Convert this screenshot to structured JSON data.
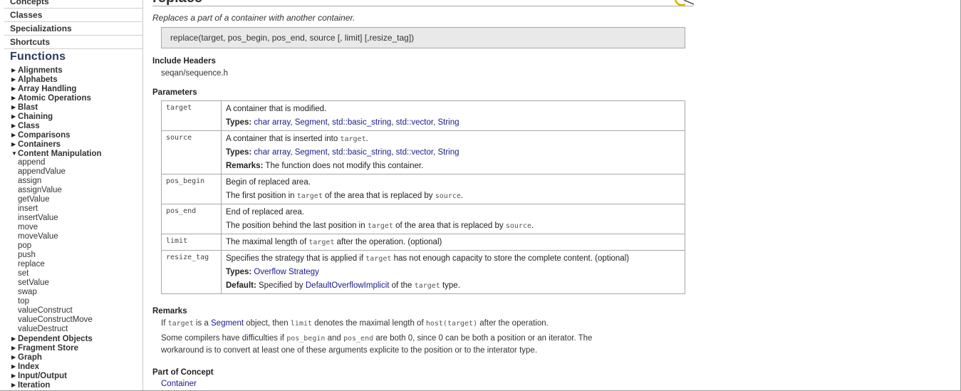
{
  "sidebar": {
    "top_links": [
      "Concepts",
      "Classes",
      "Specializations",
      "Shortcuts"
    ],
    "section_title": "Functions",
    "tree_before": [
      "Alignments",
      "Alphabets",
      "Array Handling",
      "Atomic Operations",
      "Blast",
      "Chaining",
      "Class",
      "Comparisons",
      "Containers"
    ],
    "expanded": "Content Manipulation",
    "sub_items": [
      "append",
      "appendValue",
      "assign",
      "assignValue",
      "getValue",
      "insert",
      "insertValue",
      "move",
      "moveValue",
      "pop",
      "push",
      "replace",
      "set",
      "setValue",
      "swap",
      "top",
      "valueConstruct",
      "valueConstructMove",
      "valueDestruct"
    ],
    "tree_after": [
      "Dependent Objects",
      "Fragment Store",
      "Graph",
      "Index",
      "Input/Output",
      "Iteration"
    ]
  },
  "main": {
    "title": "replace",
    "summary": "Replaces a part of a container with another container.",
    "signature": "replace(target, pos_begin, pos_end, source [, limit] [,resize_tag])",
    "include_heading": "Include Headers",
    "include_value": "seqan/sequence.h",
    "params_heading": "Parameters",
    "labels": {
      "types": "Types:",
      "remarks": "Remarks:",
      "default": "Default:"
    },
    "type_links": [
      "char array",
      "Segment",
      "std::basic_string",
      "std::vector",
      "String"
    ],
    "params": {
      "target": {
        "name": "target",
        "desc": "A container that is modified."
      },
      "source": {
        "name": "source",
        "desc_pre": "A container that is inserted into ",
        "desc_code": "target",
        "desc_post": ".",
        "remark": "The function does not modify this container."
      },
      "pos_begin": {
        "name": "pos_begin",
        "desc": "Begin of replaced area.",
        "l2_pre": "The first position in ",
        "l2_code1": "target",
        "l2_mid": " of the area that is replaced by ",
        "l2_code2": "source",
        "l2_post": "."
      },
      "pos_end": {
        "name": "pos_end",
        "desc": "End of replaced area.",
        "l2_pre": "The position behind the last position in ",
        "l2_code1": "target",
        "l2_mid": " of the area that is replaced by ",
        "l2_code2": "source",
        "l2_post": "."
      },
      "limit": {
        "name": "limit",
        "pre": "The maximal length of ",
        "code": "target",
        "post": " after the operation. (optional)"
      },
      "resize_tag": {
        "name": "resize_tag",
        "pre": "Specifies the strategy that is applied if ",
        "code": "target",
        "post": " has not enough capacity to store the complete content. (optional)",
        "type_link": "Overflow Strategy",
        "default_pre": "Specified by ",
        "default_link": "DefaultOverflowImplicit",
        "default_mid": " of the ",
        "default_code": "target",
        "default_post": " type."
      }
    },
    "remarks_heading": "Remarks",
    "remark1": {
      "a": "If ",
      "b": "target",
      "c": " is a ",
      "d": "Segment",
      "e": " object, then ",
      "f": "limit",
      "g": " denotes the maximal length of ",
      "h": "host(target)",
      "i": " after the operation."
    },
    "remark2": {
      "a": "Some compilers have difficulties if ",
      "b": "pos_begin",
      "c": " and ",
      "d": "pos_end",
      "e": " are both 0, since 0 can be both a position or an iterator. The",
      "f": "workaround is to convert at least one of these arguments explicite to the position or to the interator type."
    },
    "concept_heading": "Part of Concept",
    "concept_link": "Container"
  }
}
